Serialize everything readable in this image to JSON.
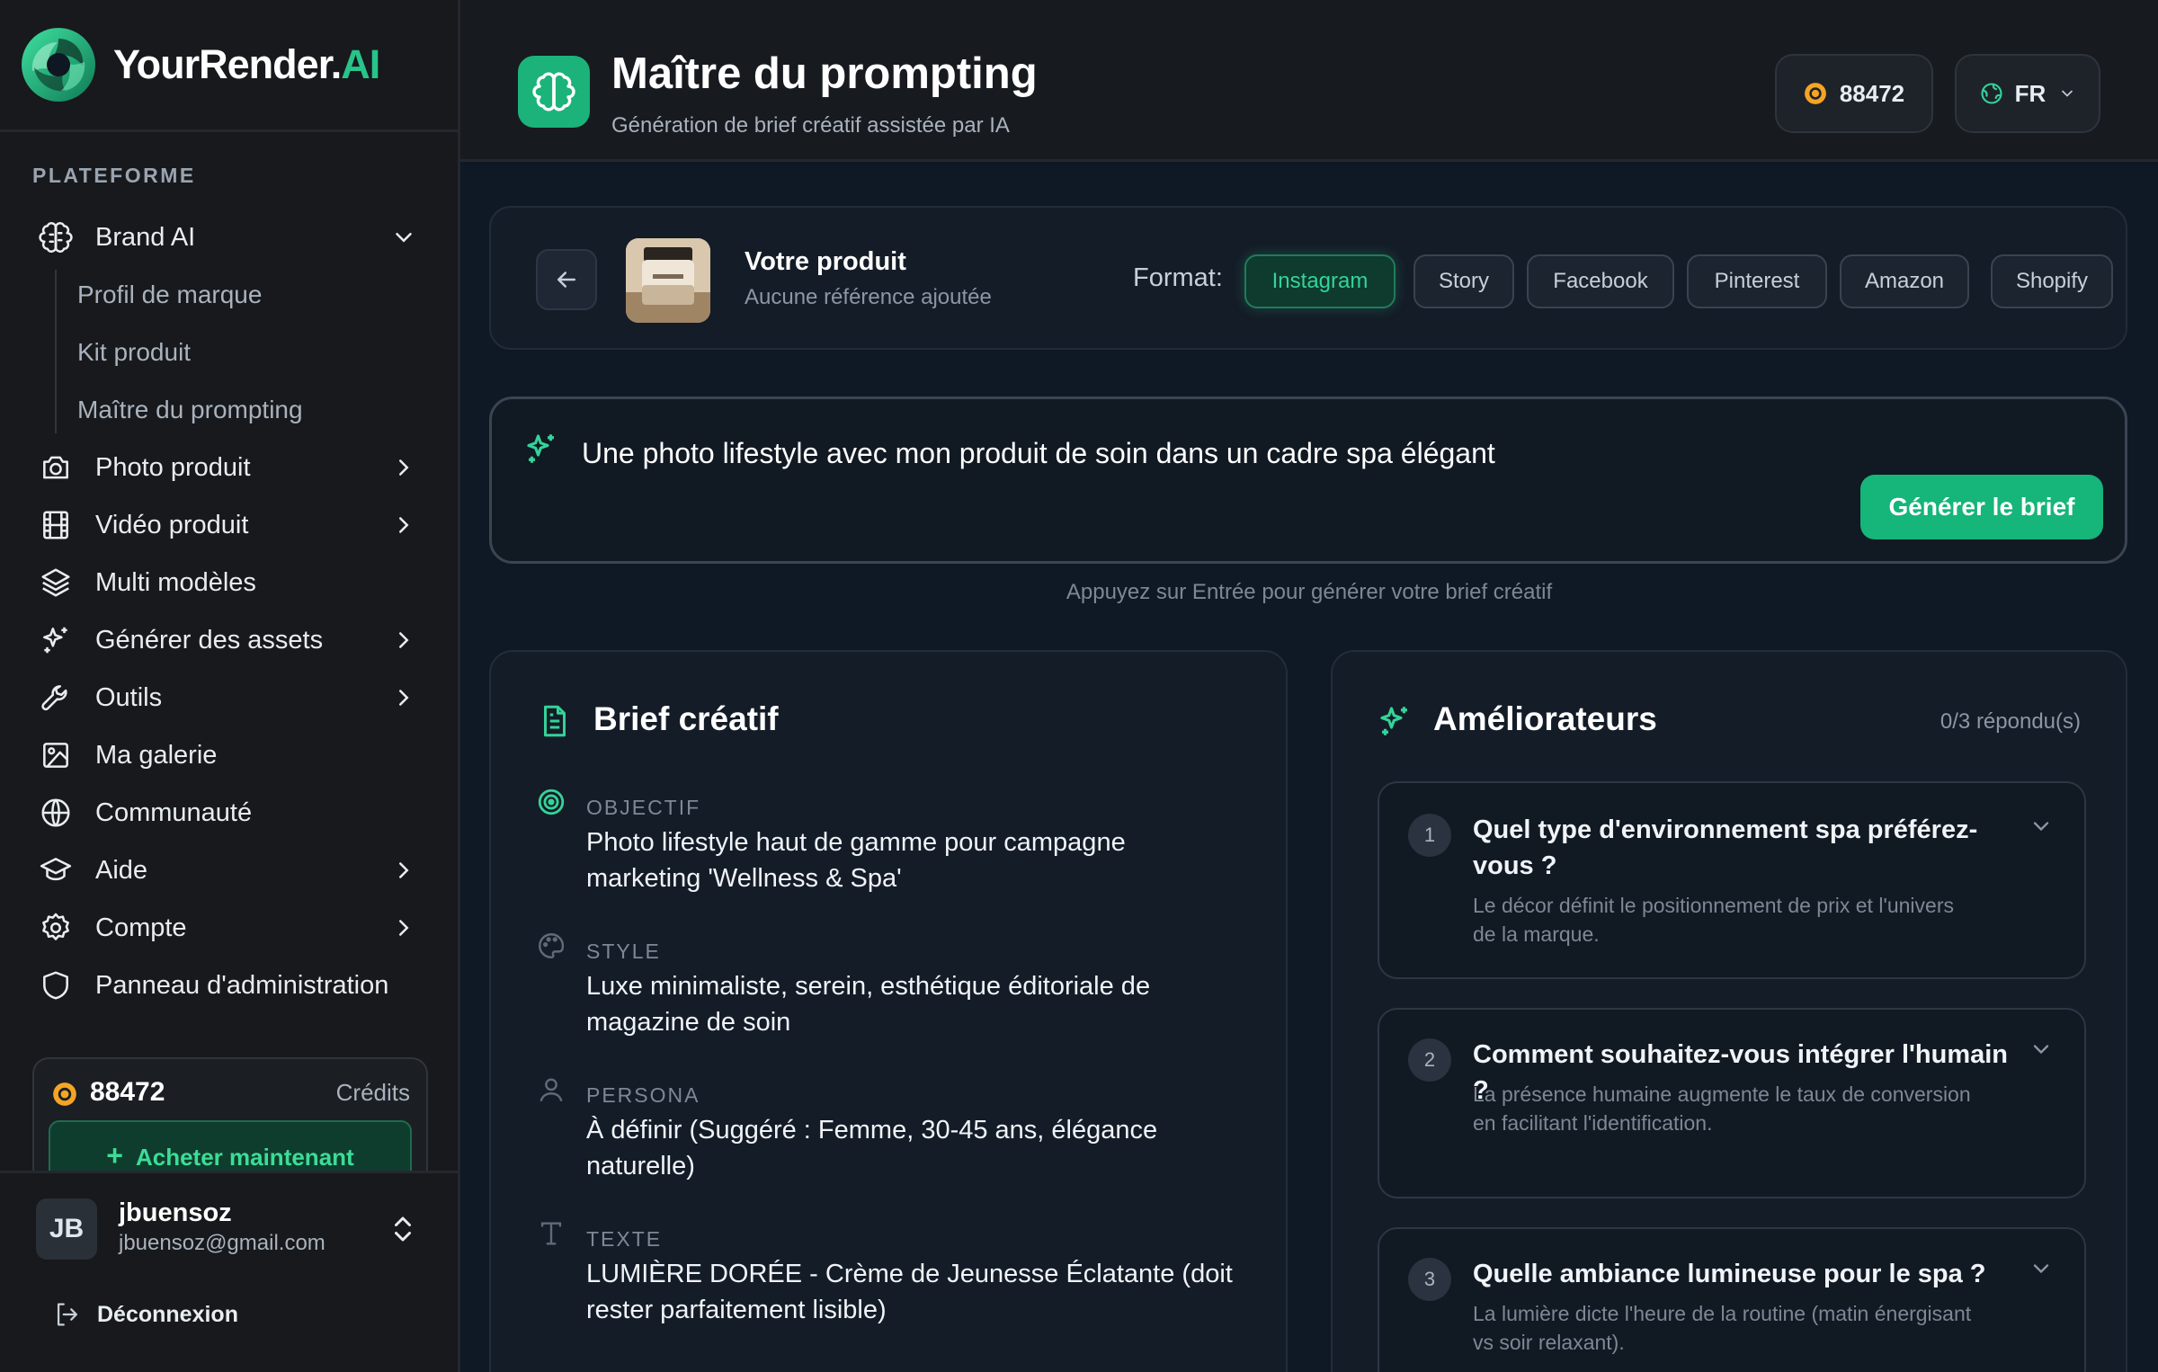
{
  "app": {
    "logo_main": "YourRender.",
    "logo_accent": "AI"
  },
  "sidebar": {
    "section_label": "PLATEFORME",
    "items": [
      {
        "label": "Brand AI",
        "icon": "brain-icon",
        "chevron": "down"
      },
      {
        "label": "Photo produit",
        "icon": "camera-icon",
        "chevron": "right"
      },
      {
        "label": "Vidéo produit",
        "icon": "film-icon",
        "chevron": "right"
      },
      {
        "label": "Multi modèles",
        "icon": "layers-icon",
        "chevron": ""
      },
      {
        "label": "Générer des assets",
        "icon": "sparkles-icon",
        "chevron": "right"
      },
      {
        "label": "Outils",
        "icon": "wrench-icon",
        "chevron": "right"
      },
      {
        "label": "Ma galerie",
        "icon": "image-icon",
        "chevron": ""
      },
      {
        "label": "Communauté",
        "icon": "globe-icon",
        "chevron": ""
      },
      {
        "label": "Aide",
        "icon": "graduation-cap-icon",
        "chevron": "right"
      },
      {
        "label": "Compte",
        "icon": "settings-icon",
        "chevron": "right"
      },
      {
        "label": "Panneau d'administration",
        "icon": "shield-icon",
        "chevron": ""
      }
    ],
    "sub_items": [
      "Profil de marque",
      "Kit produit",
      "Maître du prompting"
    ],
    "credits": {
      "amount": "88472",
      "label": "Crédits",
      "buy_label": "Acheter maintenant"
    },
    "user": {
      "initials": "JB",
      "name": "jbuensoz",
      "email": "jbuensoz@gmail.com"
    },
    "logout_label": "Déconnexion"
  },
  "header": {
    "title": "Maître du prompting",
    "subtitle": "Génération de brief créatif assistée par IA",
    "credits": "88472",
    "language": "FR"
  },
  "product": {
    "title": "Votre produit",
    "subtitle": "Aucune référence ajoutée",
    "format_label": "Format:",
    "formats": [
      "Instagram",
      "Story",
      "Facebook",
      "Pinterest",
      "Amazon",
      "Shopify"
    ],
    "active_format": "Instagram"
  },
  "prompt": {
    "text": "Une photo lifestyle avec mon produit de soin dans un cadre spa élégant",
    "button_label": "Générer le brief",
    "hint": "Appuyez sur Entrée pour générer votre brief créatif"
  },
  "brief": {
    "title": "Brief créatif",
    "fields": [
      {
        "label": "OBJECTIF",
        "value": "Photo lifestyle haut de gamme pour campagne marketing 'Wellness & Spa'",
        "icon": "target-icon"
      },
      {
        "label": "STYLE",
        "value": "Luxe minimaliste, serein, esthétique éditoriale de magazine de soin",
        "icon": "palette-icon"
      },
      {
        "label": "PERSONA",
        "value": "À définir (Suggéré : Femme, 30-45 ans, élégance naturelle)",
        "icon": "user-icon"
      },
      {
        "label": "TEXTE",
        "value": "LUMIÈRE DORÉE - Crème de Jeunesse Éclatante (doit rester parfaitement lisible)",
        "icon": "type-icon"
      }
    ]
  },
  "improvers": {
    "title": "Améliorateurs",
    "counter": "0/3 répondu(s)",
    "questions": [
      {
        "num": "1",
        "text": "Quel type d'environnement spa préférez-vous ?",
        "desc": "Le décor définit le positionnement de prix et l'univers de la marque."
      },
      {
        "num": "2",
        "text": "Comment souhaitez-vous intégrer l'humain ?",
        "desc": "La présence humaine augmente le taux de conversion en facilitant l'identification."
      },
      {
        "num": "3",
        "text": "Quelle ambiance lumineuse pour le spa ?",
        "desc": "La lumière dicte l'heure de la routine (matin énergisant vs soir relaxant)."
      }
    ]
  },
  "colors": {
    "accent": "#16b57a",
    "accent_text": "#34d399",
    "coin": "#f5a524"
  }
}
